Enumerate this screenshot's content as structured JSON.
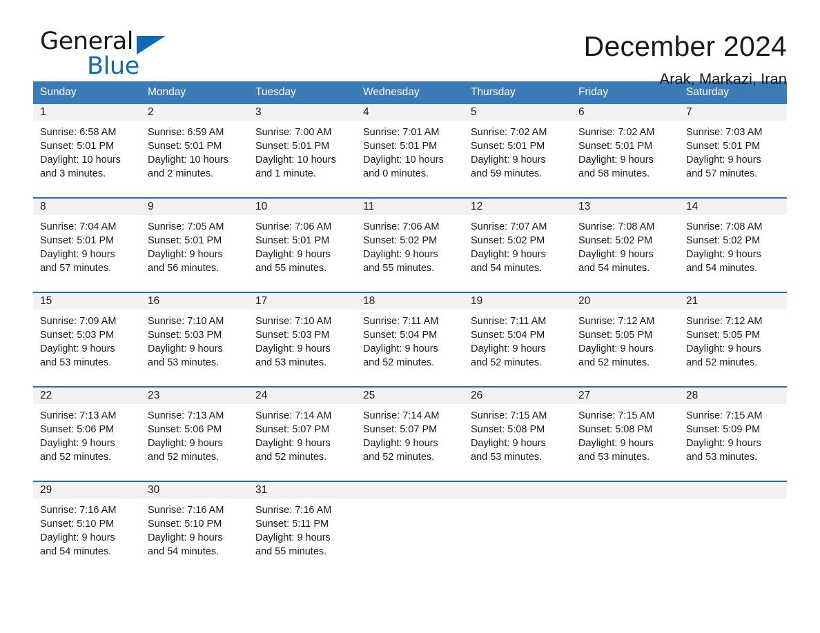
{
  "logo": {
    "word_one": "General",
    "word_two": "Blue",
    "triangle_icon": "triangle-icon",
    "brand_blue": "#1268b3"
  },
  "header": {
    "title": "December 2024",
    "subtitle": "Arak, Markazi, Iran"
  },
  "colors": {
    "header_band": "#3b7cb8",
    "row_divider": "#2e6da4",
    "daynum_band": "#f2f2f2",
    "text": "#1a1a1a"
  },
  "weekdays": [
    "Sunday",
    "Monday",
    "Tuesday",
    "Wednesday",
    "Thursday",
    "Friday",
    "Saturday"
  ],
  "weeks": [
    [
      {
        "day": "1",
        "sunrise": "Sunrise: 6:58 AM",
        "sunset": "Sunset: 5:01 PM",
        "daylight_line1": "Daylight: 10 hours",
        "daylight_line2": "and 3 minutes."
      },
      {
        "day": "2",
        "sunrise": "Sunrise: 6:59 AM",
        "sunset": "Sunset: 5:01 PM",
        "daylight_line1": "Daylight: 10 hours",
        "daylight_line2": "and 2 minutes."
      },
      {
        "day": "3",
        "sunrise": "Sunrise: 7:00 AM",
        "sunset": "Sunset: 5:01 PM",
        "daylight_line1": "Daylight: 10 hours",
        "daylight_line2": "and 1 minute."
      },
      {
        "day": "4",
        "sunrise": "Sunrise: 7:01 AM",
        "sunset": "Sunset: 5:01 PM",
        "daylight_line1": "Daylight: 10 hours",
        "daylight_line2": "and 0 minutes."
      },
      {
        "day": "5",
        "sunrise": "Sunrise: 7:02 AM",
        "sunset": "Sunset: 5:01 PM",
        "daylight_line1": "Daylight: 9 hours",
        "daylight_line2": "and 59 minutes."
      },
      {
        "day": "6",
        "sunrise": "Sunrise: 7:02 AM",
        "sunset": "Sunset: 5:01 PM",
        "daylight_line1": "Daylight: 9 hours",
        "daylight_line2": "and 58 minutes."
      },
      {
        "day": "7",
        "sunrise": "Sunrise: 7:03 AM",
        "sunset": "Sunset: 5:01 PM",
        "daylight_line1": "Daylight: 9 hours",
        "daylight_line2": "and 57 minutes."
      }
    ],
    [
      {
        "day": "8",
        "sunrise": "Sunrise: 7:04 AM",
        "sunset": "Sunset: 5:01 PM",
        "daylight_line1": "Daylight: 9 hours",
        "daylight_line2": "and 57 minutes."
      },
      {
        "day": "9",
        "sunrise": "Sunrise: 7:05 AM",
        "sunset": "Sunset: 5:01 PM",
        "daylight_line1": "Daylight: 9 hours",
        "daylight_line2": "and 56 minutes."
      },
      {
        "day": "10",
        "sunrise": "Sunrise: 7:06 AM",
        "sunset": "Sunset: 5:01 PM",
        "daylight_line1": "Daylight: 9 hours",
        "daylight_line2": "and 55 minutes."
      },
      {
        "day": "11",
        "sunrise": "Sunrise: 7:06 AM",
        "sunset": "Sunset: 5:02 PM",
        "daylight_line1": "Daylight: 9 hours",
        "daylight_line2": "and 55 minutes."
      },
      {
        "day": "12",
        "sunrise": "Sunrise: 7:07 AM",
        "sunset": "Sunset: 5:02 PM",
        "daylight_line1": "Daylight: 9 hours",
        "daylight_line2": "and 54 minutes."
      },
      {
        "day": "13",
        "sunrise": "Sunrise: 7:08 AM",
        "sunset": "Sunset: 5:02 PM",
        "daylight_line1": "Daylight: 9 hours",
        "daylight_line2": "and 54 minutes."
      },
      {
        "day": "14",
        "sunrise": "Sunrise: 7:08 AM",
        "sunset": "Sunset: 5:02 PM",
        "daylight_line1": "Daylight: 9 hours",
        "daylight_line2": "and 54 minutes."
      }
    ],
    [
      {
        "day": "15",
        "sunrise": "Sunrise: 7:09 AM",
        "sunset": "Sunset: 5:03 PM",
        "daylight_line1": "Daylight: 9 hours",
        "daylight_line2": "and 53 minutes."
      },
      {
        "day": "16",
        "sunrise": "Sunrise: 7:10 AM",
        "sunset": "Sunset: 5:03 PM",
        "daylight_line1": "Daylight: 9 hours",
        "daylight_line2": "and 53 minutes."
      },
      {
        "day": "17",
        "sunrise": "Sunrise: 7:10 AM",
        "sunset": "Sunset: 5:03 PM",
        "daylight_line1": "Daylight: 9 hours",
        "daylight_line2": "and 53 minutes."
      },
      {
        "day": "18",
        "sunrise": "Sunrise: 7:11 AM",
        "sunset": "Sunset: 5:04 PM",
        "daylight_line1": "Daylight: 9 hours",
        "daylight_line2": "and 52 minutes."
      },
      {
        "day": "19",
        "sunrise": "Sunrise: 7:11 AM",
        "sunset": "Sunset: 5:04 PM",
        "daylight_line1": "Daylight: 9 hours",
        "daylight_line2": "and 52 minutes."
      },
      {
        "day": "20",
        "sunrise": "Sunrise: 7:12 AM",
        "sunset": "Sunset: 5:05 PM",
        "daylight_line1": "Daylight: 9 hours",
        "daylight_line2": "and 52 minutes."
      },
      {
        "day": "21",
        "sunrise": "Sunrise: 7:12 AM",
        "sunset": "Sunset: 5:05 PM",
        "daylight_line1": "Daylight: 9 hours",
        "daylight_line2": "and 52 minutes."
      }
    ],
    [
      {
        "day": "22",
        "sunrise": "Sunrise: 7:13 AM",
        "sunset": "Sunset: 5:06 PM",
        "daylight_line1": "Daylight: 9 hours",
        "daylight_line2": "and 52 minutes."
      },
      {
        "day": "23",
        "sunrise": "Sunrise: 7:13 AM",
        "sunset": "Sunset: 5:06 PM",
        "daylight_line1": "Daylight: 9 hours",
        "daylight_line2": "and 52 minutes."
      },
      {
        "day": "24",
        "sunrise": "Sunrise: 7:14 AM",
        "sunset": "Sunset: 5:07 PM",
        "daylight_line1": "Daylight: 9 hours",
        "daylight_line2": "and 52 minutes."
      },
      {
        "day": "25",
        "sunrise": "Sunrise: 7:14 AM",
        "sunset": "Sunset: 5:07 PM",
        "daylight_line1": "Daylight: 9 hours",
        "daylight_line2": "and 52 minutes."
      },
      {
        "day": "26",
        "sunrise": "Sunrise: 7:15 AM",
        "sunset": "Sunset: 5:08 PM",
        "daylight_line1": "Daylight: 9 hours",
        "daylight_line2": "and 53 minutes."
      },
      {
        "day": "27",
        "sunrise": "Sunrise: 7:15 AM",
        "sunset": "Sunset: 5:08 PM",
        "daylight_line1": "Daylight: 9 hours",
        "daylight_line2": "and 53 minutes."
      },
      {
        "day": "28",
        "sunrise": "Sunrise: 7:15 AM",
        "sunset": "Sunset: 5:09 PM",
        "daylight_line1": "Daylight: 9 hours",
        "daylight_line2": "and 53 minutes."
      }
    ],
    [
      {
        "day": "29",
        "sunrise": "Sunrise: 7:16 AM",
        "sunset": "Sunset: 5:10 PM",
        "daylight_line1": "Daylight: 9 hours",
        "daylight_line2": "and 54 minutes."
      },
      {
        "day": "30",
        "sunrise": "Sunrise: 7:16 AM",
        "sunset": "Sunset: 5:10 PM",
        "daylight_line1": "Daylight: 9 hours",
        "daylight_line2": "and 54 minutes."
      },
      {
        "day": "31",
        "sunrise": "Sunrise: 7:16 AM",
        "sunset": "Sunset: 5:11 PM",
        "daylight_line1": "Daylight: 9 hours",
        "daylight_line2": "and 55 minutes."
      },
      {
        "day": "",
        "sunrise": "",
        "sunset": "",
        "daylight_line1": "",
        "daylight_line2": ""
      },
      {
        "day": "",
        "sunrise": "",
        "sunset": "",
        "daylight_line1": "",
        "daylight_line2": ""
      },
      {
        "day": "",
        "sunrise": "",
        "sunset": "",
        "daylight_line1": "",
        "daylight_line2": ""
      },
      {
        "day": "",
        "sunrise": "",
        "sunset": "",
        "daylight_line1": "",
        "daylight_line2": ""
      }
    ]
  ]
}
